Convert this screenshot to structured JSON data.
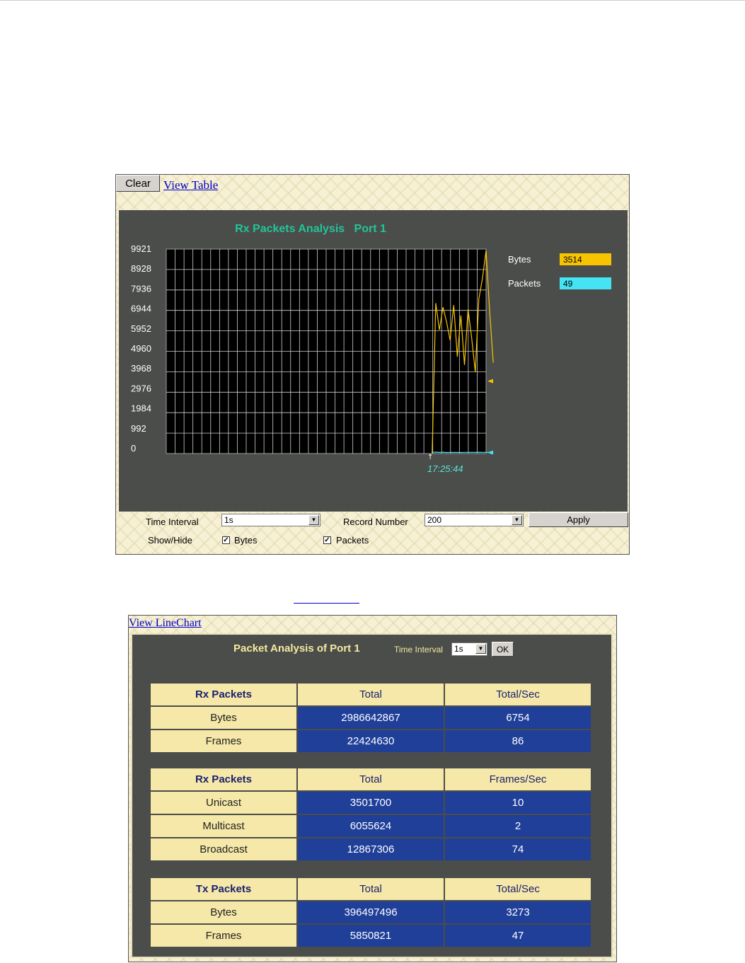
{
  "line_chart_panel": {
    "clear_label": "Clear",
    "view_table_label": "View Table",
    "chart_title": "Rx Packets Analysis   Port 1",
    "legend": [
      {
        "label": "Bytes",
        "value": "3514",
        "color": "#f8c400"
      },
      {
        "label": "Packets",
        "value": "49",
        "color": "#44e4f4"
      }
    ],
    "timestamp": "17:25:44",
    "controls": {
      "time_interval_label": "Time Interval",
      "time_interval_value": "1s",
      "record_number_label": "Record Number",
      "record_number_value": "200",
      "apply_label": "Apply",
      "show_hide_label": "Show/Hide",
      "bytes_label": "Bytes",
      "packets_label": "Packets",
      "bytes_checked": true,
      "packets_checked": true
    }
  },
  "chart_data": {
    "type": "line",
    "title": "Rx Packets Analysis   Port 1",
    "xlabel": "",
    "ylabel": "",
    "ylim": [
      0,
      9921
    ],
    "yticks": [
      "9921",
      "8928",
      "7936",
      "6944",
      "5952",
      "4960",
      "3968",
      "2976",
      "1984",
      "992",
      "0"
    ],
    "grid": true,
    "legend_position": "right",
    "x_points": 90,
    "series": [
      {
        "name": "Bytes",
        "color": "#f8c400",
        "start_index": 74,
        "values": [
          0,
          7300,
          6000,
          7100,
          6400,
          5500,
          7200,
          4700,
          6700,
          4300,
          7000,
          5600,
          3950,
          7500,
          8500,
          9850,
          6900,
          4400
        ]
      },
      {
        "name": "Packets",
        "color": "#44e4f4",
        "start_index": 74,
        "values": [
          60,
          70,
          55,
          65,
          50,
          60,
          55,
          58,
          52,
          60,
          57,
          62,
          55,
          65,
          60,
          58,
          55,
          49
        ]
      }
    ],
    "current_markers": {
      "Bytes": 3514,
      "Packets": 49
    }
  },
  "table_panel": {
    "view_linechart_label": "View LineChart",
    "title": "Packet Analysis of Port 1",
    "time_interval_label": "Time Interval",
    "time_interval_value": "1s",
    "ok_label": "OK",
    "groups": [
      {
        "headers": [
          "Rx Packets",
          "Total",
          "Total/Sec"
        ],
        "rows": [
          [
            "Bytes",
            "2986642867",
            "6754"
          ],
          [
            "Frames",
            "22424630",
            "86"
          ]
        ]
      },
      {
        "headers": [
          "Rx Packets",
          "Total",
          "Frames/Sec"
        ],
        "rows": [
          [
            "Unicast",
            "3501700",
            "10"
          ],
          [
            "Multicast",
            "6055624",
            "2"
          ],
          [
            "Broadcast",
            "12867306",
            "74"
          ]
        ]
      },
      {
        "headers": [
          "Tx Packets",
          "Total",
          "Total/Sec"
        ],
        "rows": [
          [
            "Bytes",
            "396497496",
            "3273"
          ],
          [
            "Frames",
            "5850821",
            "47"
          ]
        ]
      }
    ]
  }
}
